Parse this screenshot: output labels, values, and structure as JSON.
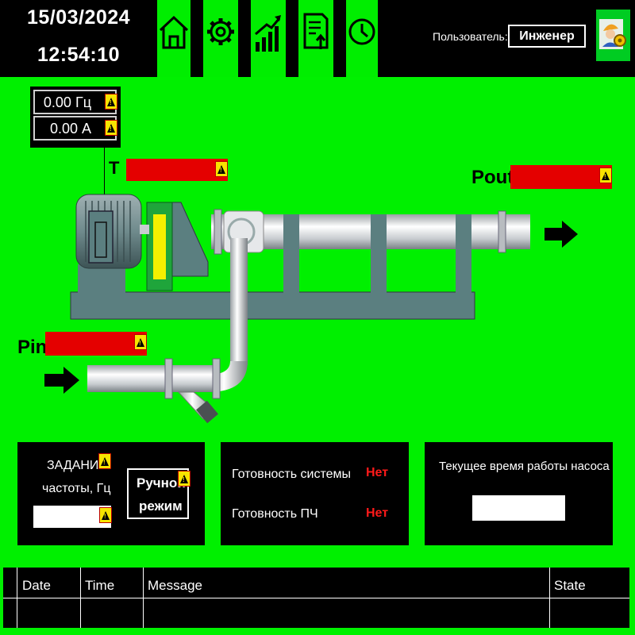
{
  "header": {
    "date": "15/03/2024",
    "time": "12:54:10",
    "nav": [
      {
        "icon": "home-icon"
      },
      {
        "icon": "gear-icon"
      },
      {
        "icon": "chart-icon"
      },
      {
        "icon": "report-upload-icon"
      },
      {
        "icon": "clock-icon"
      }
    ],
    "user_label": "Пользователь:",
    "user_name": "Инженер",
    "user_icon": "engineer-user-icon"
  },
  "drive": {
    "frequency": "0.00 Гц",
    "current": "0.00 А"
  },
  "sensors": {
    "temperature_label": "T",
    "pressure_out_label": "Pout",
    "pressure_in_label": "Pin"
  },
  "setpoint_panel": {
    "title_line1": "ЗАДАНИЕ",
    "title_line2": "частоты, Гц",
    "value": "",
    "mode_button_line1": "Ручной",
    "mode_button_line2": "режим"
  },
  "status_panel": {
    "system_ready_label": "Готовность системы",
    "system_ready_value": "Нет",
    "vfd_ready_label": "Готовность ПЧ",
    "vfd_ready_value": "Нет"
  },
  "runtime_panel": {
    "title": "Текущее время работы насоса",
    "value": ""
  },
  "alarm_table": {
    "columns": [
      "Date",
      "Time",
      "Message",
      "State"
    ],
    "rows": []
  },
  "colors": {
    "background": "#00f000",
    "alarm_red": "#e40000",
    "status_red": "#ff1a1a",
    "warning_yellow": "#f7e400"
  }
}
